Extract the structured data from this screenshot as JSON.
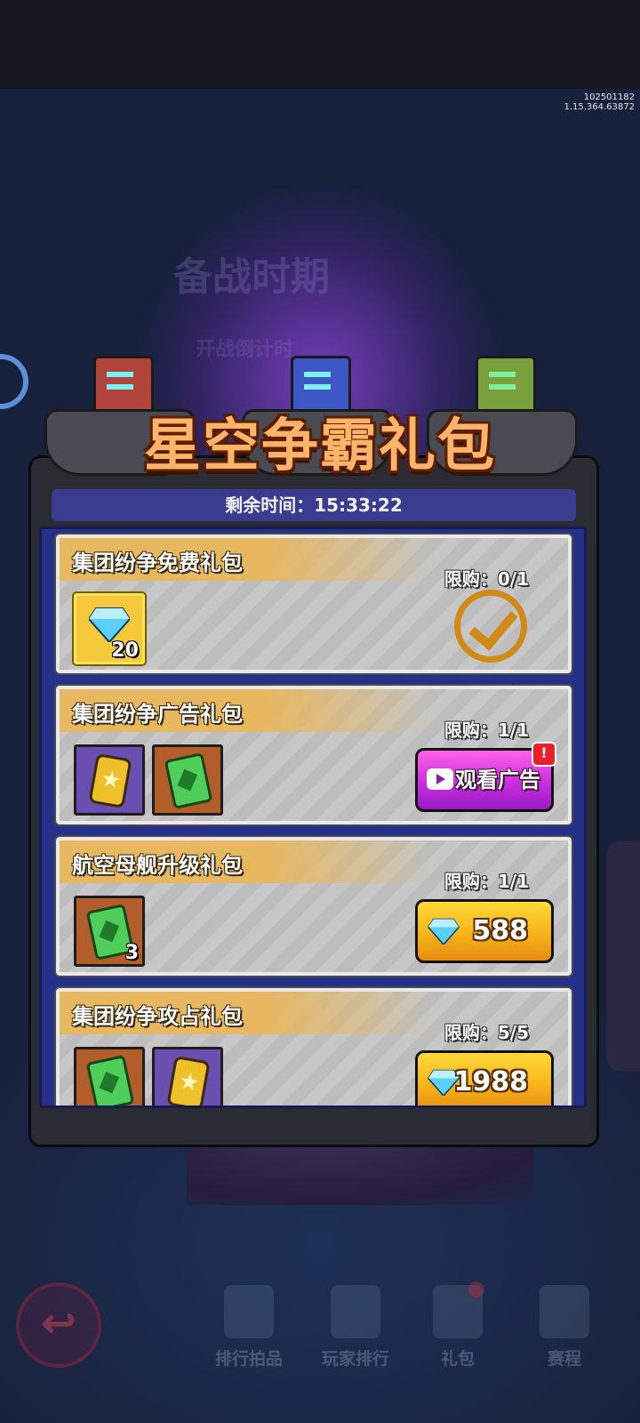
{
  "version": {
    "line1": "102501182",
    "line2": "1.15.364.63872"
  },
  "background": {
    "ghost_title": "备战时期",
    "ghost_subtitle": "开战倒计时"
  },
  "popup": {
    "title": "星空争霸礼包",
    "timer": "剩余时间：15:33:22",
    "packs": [
      {
        "title": "集团纷争免费礼包",
        "limit": "限购：0/1",
        "items": [
          {
            "type": "diamond",
            "rarity": "gold",
            "qty": "20"
          }
        ],
        "status": "claimed",
        "action_icon": "checkmark-icon"
      },
      {
        "title": "集团纷争广告礼包",
        "limit": "限购：1/1",
        "items": [
          {
            "type": "gold-can",
            "rarity": "purple"
          },
          {
            "type": "green-book",
            "rarity": "orange"
          }
        ],
        "button": {
          "label": "观看广告",
          "icon": "play-video-icon",
          "badge": "!"
        }
      },
      {
        "title": "航空母舰升级礼包",
        "limit": "限购：1/1",
        "items": [
          {
            "type": "green-book",
            "rarity": "orange",
            "qty": "3"
          }
        ],
        "button": {
          "label": "588",
          "icon": "diamond-icon"
        }
      },
      {
        "title": "集团纷争攻占礼包",
        "limit": "限购：5/5",
        "items": [
          {
            "type": "green-book",
            "rarity": "orange"
          },
          {
            "type": "gold-can",
            "rarity": "purple"
          }
        ],
        "button": {
          "label": "1988",
          "icon": "diamond-icon"
        }
      }
    ]
  },
  "bottom_nav": {
    "back_icon": "back-arrow-icon",
    "items": [
      {
        "label": "排行拍品",
        "icon": "tv-icon"
      },
      {
        "label": "玩家排行",
        "icon": "podium-icon"
      },
      {
        "label": "礼包",
        "icon": "gift-icon"
      },
      {
        "label": "赛程",
        "icon": "schedule-icon"
      }
    ]
  },
  "colors": {
    "panel_blue": "#24308a",
    "ad_button": "#c82fe0",
    "gem_button": "#f7b41a",
    "check": "#d08a16",
    "title_orange": "#ffb46a"
  }
}
